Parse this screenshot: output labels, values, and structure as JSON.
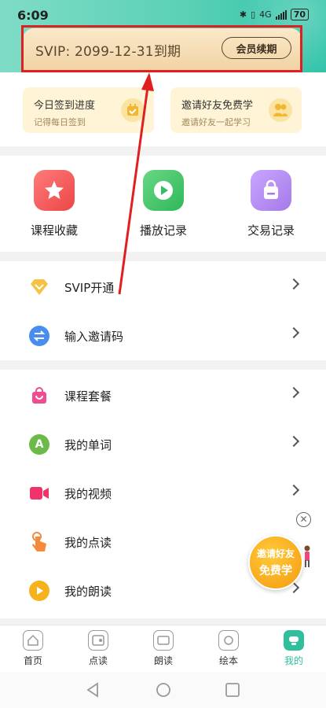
{
  "status_bar": {
    "time": "6:09",
    "network": "4G",
    "battery": "70"
  },
  "vip_card": {
    "text": "SVIP: 2099-12-31到期",
    "renew_button": "会员续期"
  },
  "mini_cards": [
    {
      "title": "今日签到进度",
      "subtitle": "记得每日签到",
      "icon": "calendar-check-icon"
    },
    {
      "title": "邀请好友免费学",
      "subtitle": "邀请好友一起学习",
      "icon": "friends-icon"
    }
  ],
  "quick_grid": [
    {
      "label": "课程收藏",
      "icon": "star-icon",
      "color": "#f15a5a"
    },
    {
      "label": "播放记录",
      "icon": "play-icon",
      "color": "#3fc66a"
    },
    {
      "label": "交易记录",
      "icon": "bag-icon",
      "color": "#b68ff0"
    }
  ],
  "list_a": [
    {
      "label": "SVIP开通",
      "icon": "diamond-icon",
      "color": "#f6c244"
    },
    {
      "label": "输入邀请码",
      "icon": "exchange-icon",
      "color": "#4a8df0"
    }
  ],
  "list_b": [
    {
      "label": "课程套餐",
      "icon": "shopping-bag-icon",
      "color": "#ee4d8f"
    },
    {
      "label": "我的单词",
      "icon": "letter-a-icon",
      "color": "#6cba4a"
    },
    {
      "label": "我的视频",
      "icon": "video-camera-icon",
      "color": "#f0336a"
    },
    {
      "label": "我的点读",
      "icon": "finger-tap-icon",
      "color": "#f58a3c"
    },
    {
      "label": "我的朗读",
      "icon": "play-circle-icon",
      "color": "#f6b21c"
    }
  ],
  "invite_float": {
    "line1": "邀请好友",
    "line2": "免费学"
  },
  "tabbar": {
    "tabs": [
      {
        "label": "首页",
        "icon": "home-icon",
        "active": false
      },
      {
        "label": "点读",
        "icon": "point-read-icon",
        "active": false
      },
      {
        "label": "朗读",
        "icon": "read-aloud-icon",
        "active": false
      },
      {
        "label": "绘本",
        "icon": "picture-book-icon",
        "active": false
      },
      {
        "label": "我的",
        "icon": "mine-icon",
        "active": true
      }
    ],
    "active_color": "#2fbf9d"
  },
  "annotation": {
    "box_color": "#e02020",
    "arrow_color": "#e02020"
  }
}
